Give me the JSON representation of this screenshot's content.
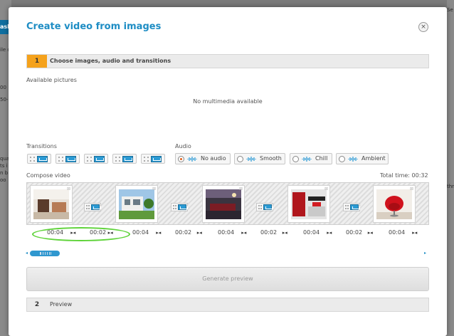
{
  "background": {
    "left_fragments": [
      "ask",
      "ile o",
      "00",
      "50-",
      "qua",
      "ts i",
      "n b",
      "oo"
    ],
    "right_fragments": [
      "Se",
      "thro"
    ]
  },
  "modal": {
    "title": "Create video from images",
    "close_icon": "×"
  },
  "step1": {
    "number": "1",
    "label": "Choose images, audio and transitions"
  },
  "available_pictures": {
    "label": "Available pictures",
    "empty_text": "No multimedia available"
  },
  "transitions": {
    "label": "Transitions",
    "count": 5
  },
  "audio": {
    "label": "Audio",
    "options": [
      {
        "label": "No audio",
        "selected": true
      },
      {
        "label": "Smooth",
        "selected": false
      },
      {
        "label": "Chill",
        "selected": false
      },
      {
        "label": "Ambient",
        "selected": false
      }
    ]
  },
  "compose": {
    "label": "Compose video",
    "total_label": "Total time:",
    "total_value": "00:32"
  },
  "timeline_times": {
    "t1": "00:04",
    "t2": "00:02",
    "t3": "00:04",
    "t4": "00:02",
    "t5": "00:04",
    "t6": "00:02",
    "t7": "00:04",
    "t8": "00:02",
    "t9": "00:04"
  },
  "generate_button": "Generate preview",
  "step2": {
    "number": "2",
    "label": "Preview"
  },
  "colors": {
    "accent": "#1e8dc4",
    "step_active": "#f5a21c",
    "highlight_ellipse": "#5fd33a"
  }
}
